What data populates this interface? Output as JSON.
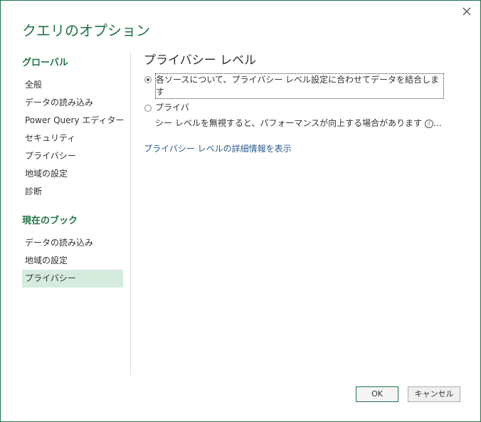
{
  "dialog": {
    "title": "クエリのオプション",
    "close_icon": "close-icon"
  },
  "sidebar": {
    "global_heading": "グローバル",
    "global_items": [
      {
        "label": "全般"
      },
      {
        "label": "データの読み込み"
      },
      {
        "label": "Power Query エディター"
      },
      {
        "label": "セキュリティ"
      },
      {
        "label": "プライバシー"
      },
      {
        "label": "地域の設定"
      },
      {
        "label": "診断"
      }
    ],
    "workbook_heading": "現在のブック",
    "workbook_items": [
      {
        "label": "データの読み込み"
      },
      {
        "label": "地域の設定"
      },
      {
        "label": "プライバシー",
        "selected": true
      }
    ]
  },
  "content": {
    "title": "プライバシー レベル",
    "option1": {
      "label": "各ソースについて、プライバシー レベル設定に合わせてデータを結合します",
      "checked": true
    },
    "option2": {
      "label": "プライバ",
      "description": "シー レベルを無視すると、パフォーマンスが向上する場合があります",
      "truncation": "...",
      "checked": false
    },
    "link": "プライバシー レベルの詳細情報を表示"
  },
  "buttons": {
    "ok": "OK",
    "cancel": "キャンセル"
  },
  "colors": {
    "accent": "#217346",
    "selected_bg": "#d5ebde",
    "link": "#2e5d8f"
  }
}
